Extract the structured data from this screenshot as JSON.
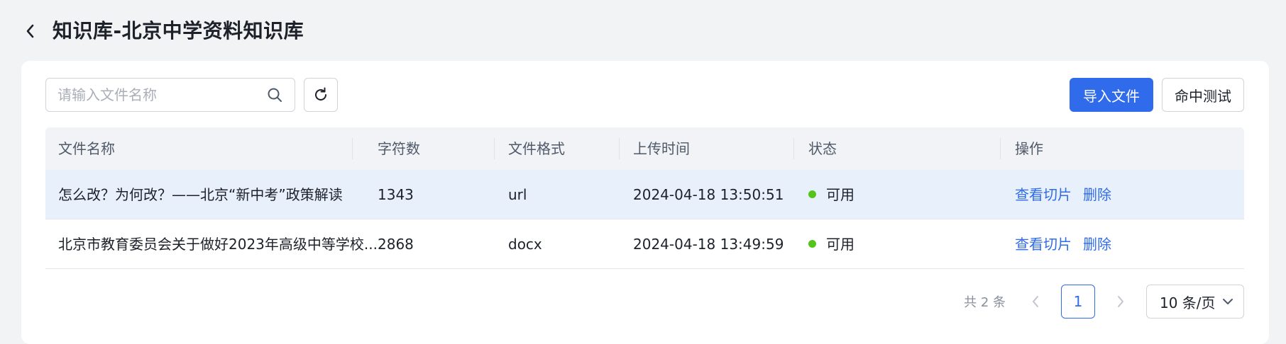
{
  "page": {
    "title": "知识库-北京中学资料知识库"
  },
  "toolbar": {
    "search_placeholder": "请输入文件名称",
    "search_value": "",
    "import_label": "导入文件",
    "hit_test_label": "命中测试"
  },
  "table": {
    "columns": [
      "文件名称",
      "字符数",
      "文件格式",
      "上传时间",
      "状态",
      "操作"
    ],
    "rows": [
      {
        "name": "怎么改？为何改？——北京“新中考”政策解读",
        "chars": "1343",
        "format": "url",
        "time": "2024-04-18 13:50:51",
        "status": "可用",
        "view": "查看切片",
        "delete": "删除"
      },
      {
        "name": "北京市教育委员会关于做好2023年高级中等学校...",
        "chars": "2868",
        "format": "docx",
        "time": "2024-04-18 13:49:59",
        "status": "可用",
        "view": "查看切片",
        "delete": "删除"
      }
    ]
  },
  "pagination": {
    "total_label": "共 2 条",
    "current_page": "1",
    "page_size": "10 条/页"
  },
  "icons": {
    "back": "chevron-left-icon",
    "search": "search-icon",
    "refresh": "refresh-icon",
    "prev": "chevron-left-icon",
    "next": "chevron-right-icon",
    "dropdown": "chevron-down-icon"
  },
  "colors": {
    "primary": "#2f6bea",
    "status_ok": "#52c41a",
    "row_hover": "#e8f0fc"
  }
}
